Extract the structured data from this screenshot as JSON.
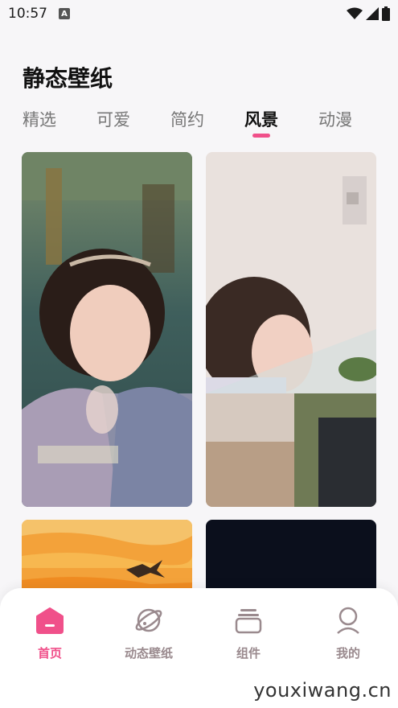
{
  "status_bar": {
    "time": "10:57",
    "notification_icon": "A"
  },
  "page_title": "静态壁纸",
  "tabs": [
    {
      "label": "精选",
      "active": false
    },
    {
      "label": "可爱",
      "active": false
    },
    {
      "label": "简约",
      "active": false
    },
    {
      "label": "风景",
      "active": true
    },
    {
      "label": "动漫",
      "active": false
    }
  ],
  "bottom_nav": [
    {
      "label": "首页",
      "icon": "home-icon",
      "active": true
    },
    {
      "label": "动态壁纸",
      "icon": "planet-icon",
      "active": false
    },
    {
      "label": "组件",
      "icon": "widget-icon",
      "active": false
    },
    {
      "label": "我的",
      "icon": "profile-icon",
      "active": false
    }
  ],
  "watermark": "youxiwang.cn",
  "colors": {
    "accent": "#f0508a",
    "inactive_nav": "#9a8a8e"
  }
}
